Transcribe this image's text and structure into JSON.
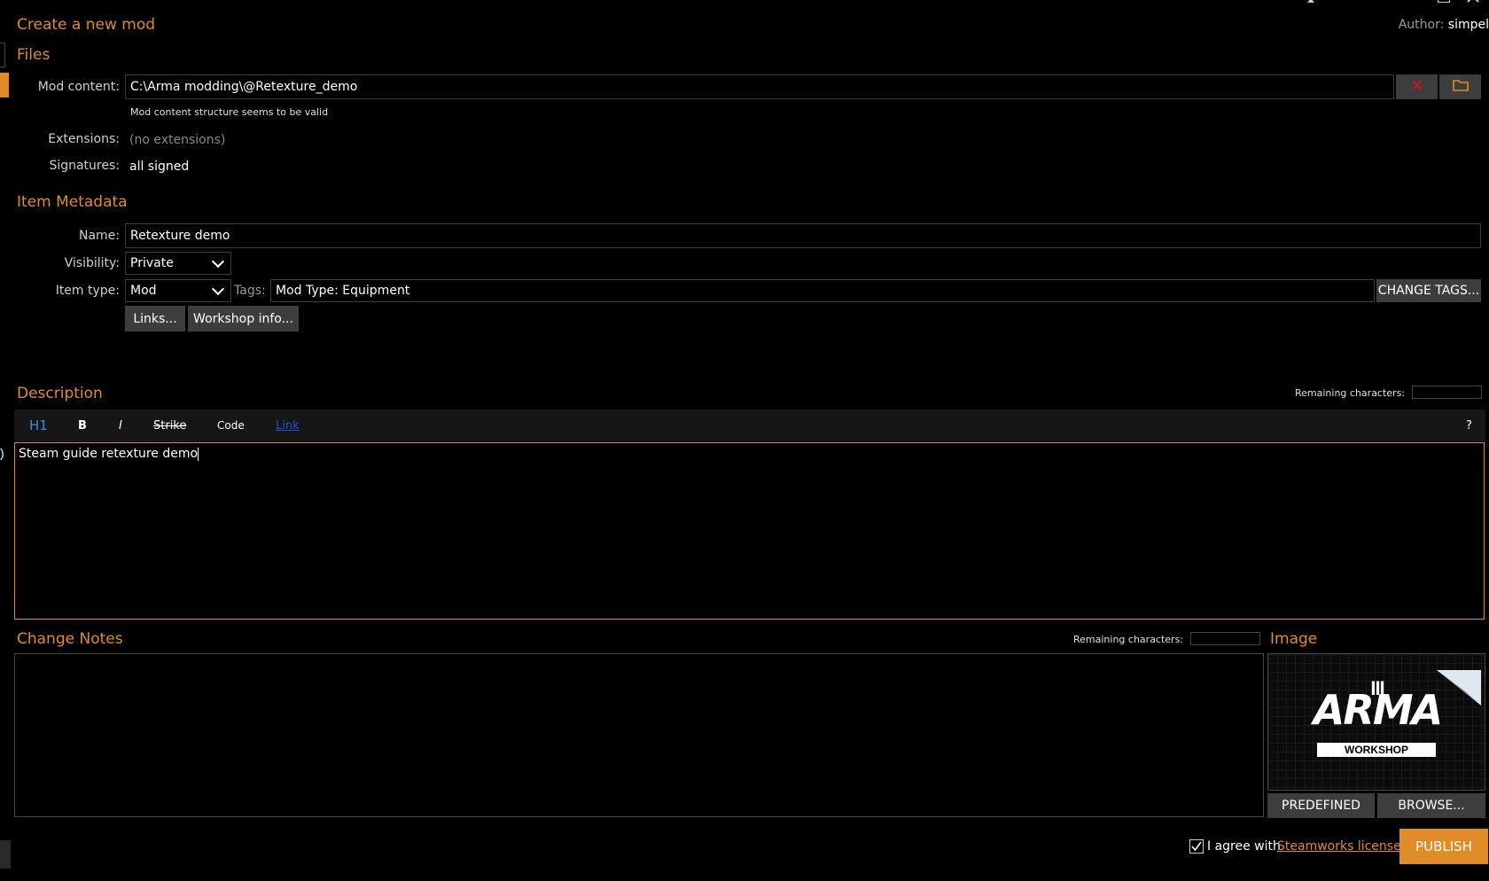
{
  "window": {
    "title": "Create a new mod",
    "author_label": "Author:",
    "author_name": "simpel"
  },
  "files": {
    "header": "Files",
    "mod_content_label": "Mod content:",
    "mod_content_value": "C:\\Arma modding\\@Retexture_demo",
    "mod_content_status": "Mod content structure seems to be valid",
    "extensions_label": "Extensions:",
    "extensions_value": "(no extensions)",
    "signatures_label": "Signatures:",
    "signatures_value": "all signed"
  },
  "metadata": {
    "header": "Item Metadata",
    "name_label": "Name:",
    "name_value": "Retexture demo",
    "visibility_label": "Visibility:",
    "visibility_value": "Private",
    "item_type_label": "Item type:",
    "item_type_value": "Mod",
    "tags_label": "Tags:",
    "tags_value": "Mod Type: Equipment",
    "change_tags_label": "CHANGE TAGS...",
    "links_label": "Links...",
    "workshop_info_label": "Workshop info..."
  },
  "description": {
    "header": "Description",
    "remaining_label": "Remaining characters:",
    "toolbar": {
      "h1": "H1",
      "bold": "B",
      "italic": "I",
      "strike": "Strike",
      "code": "Code",
      "link": "Link",
      "help": "?"
    },
    "text": "Steam guide retexture demo"
  },
  "change_notes": {
    "header": "Change Notes",
    "remaining_label": "Remaining characters:"
  },
  "image": {
    "header": "Image",
    "logo_text": "ARMA",
    "logo_numeral": "III",
    "workshop_text": "WORKSHOP",
    "predefined_label": "PREDEFINED",
    "browse_label": "BROWSE..."
  },
  "footer": {
    "agree_text": "I agree with",
    "license_link": "Steamworks license",
    "publish_label": "PUBLISH"
  },
  "colors": {
    "accent": "#e08c28",
    "background": "#000000",
    "button": "#3d3d3d",
    "link_blue": "#2a4fd6"
  }
}
